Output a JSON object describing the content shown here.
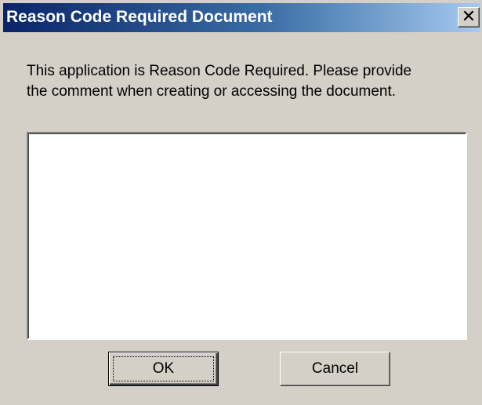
{
  "window": {
    "title": "Reason Code Required Document",
    "close_glyph": "✕"
  },
  "message": {
    "line1": "This application is Reason Code Required. Please provide",
    "line2": "the comment when creating or accessing the document."
  },
  "reason_input": {
    "value": "",
    "placeholder": ""
  },
  "buttons": {
    "ok_label": "OK",
    "cancel_label": "Cancel"
  },
  "colors": {
    "titlebar_start": "#0a246a",
    "titlebar_end": "#a6caf0",
    "dialog_background": "#d4d0c8"
  }
}
